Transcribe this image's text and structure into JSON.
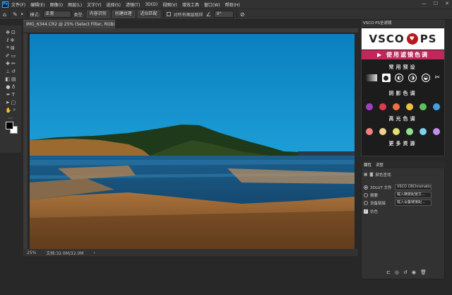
{
  "menubar": {
    "logo": "Ps",
    "items": [
      "文件(F)",
      "编辑(E)",
      "图像(I)",
      "图层(L)",
      "文字(Y)",
      "选择(S)",
      "滤镜(T)",
      "3D(D)",
      "视图(V)",
      "增效工具",
      "窗口(W)",
      "帮助(H)"
    ],
    "minimize": "—",
    "maximize": "☐",
    "close": "✕"
  },
  "options": {
    "mode_label": "模式:",
    "mode_value": "正常",
    "type_label": "类型:",
    "btn_content_aware": "内容识别",
    "btn_create_texture": "创建纹理",
    "btn_proximity": "近似匹配",
    "sample_all_layers": "对所有图层取样",
    "angle_value": "0°"
  },
  "document": {
    "tab_title": "IMG_6344.CR2 @ 25% (Select Filter, RGB/8*) *",
    "zoom": "25%",
    "doc_size": "文档:32.0M/32.0M",
    "arrow": "›"
  },
  "vsco": {
    "tab_title": "VSCO PS全滤镜",
    "brand_left": "VSCO",
    "brand_right": "PS",
    "seal_text": "♥",
    "cta": "▶ 使用滤镜色调",
    "sec_presets": "常用预设",
    "sec_shadow": "阴影色调",
    "sec_highlight": "高光色调",
    "sec_more": "更多资源",
    "shadow_colors": [
      "#a040c0",
      "#e03a50",
      "#f07040",
      "#f0c040",
      "#60c060",
      "#40a0e0"
    ],
    "highlight_colors": [
      "#f08080",
      "#f0d090",
      "#e0e070",
      "#90e090",
      "#80d0f0",
      "#c090f0"
    ]
  },
  "properties": {
    "tab_props": "属性",
    "tab_adjust": "调整",
    "layer_type": "颜色查找",
    "opt_3dlut": "3DLUT 文件",
    "opt_abstract": "摘要",
    "opt_devicelink": "设备链接",
    "opt_dither": "仿色",
    "sel_3dlut": "VSCO CBChromatic...",
    "sel_abstract": "载入摘要配置文...",
    "sel_devicelink": "载入设备链接配..."
  },
  "colors": {
    "accent": "#c0285c",
    "panel_bg": "#323232"
  }
}
